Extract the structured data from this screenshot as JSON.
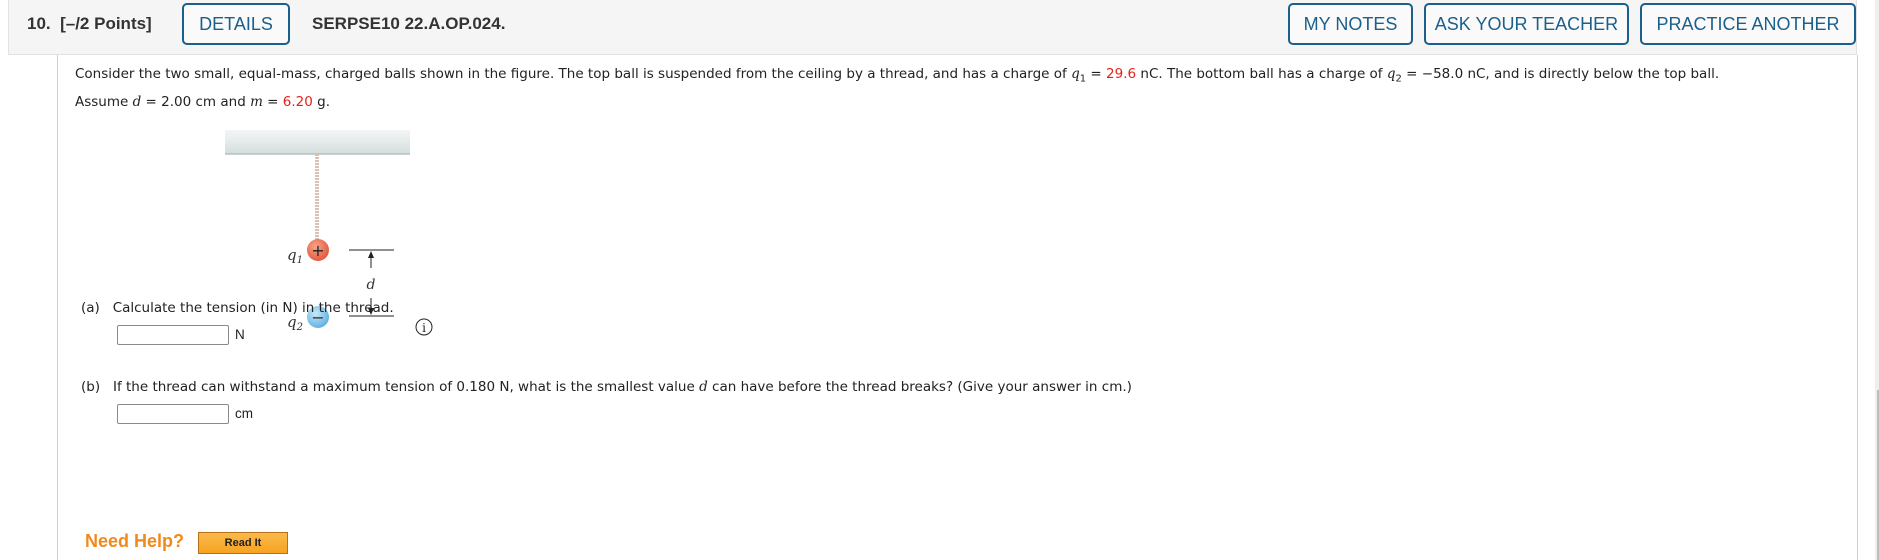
{
  "header": {
    "question_number": "10.",
    "points": "[–/2 Points]",
    "details_label": "DETAILS",
    "problem_code": "SERPSE10 22.A.OP.024.",
    "buttons": {
      "my_notes": "MY NOTES",
      "ask_teacher": "ASK YOUR TEACHER",
      "practice_another": "PRACTICE ANOTHER"
    },
    "accent_color": "#1b5f8c"
  },
  "problem": {
    "t1": "Consider the two small, equal-mass, charged balls shown in the figure. The top ball is suspended from the ceiling by a thread, and has a charge of ",
    "q1_sym": "q",
    "q1_sub": "1",
    "eq1": " = ",
    "q1_value": "29.6",
    "t2": " nC. The bottom ball has a charge of ",
    "q2_sym": "q",
    "q2_sub": "2",
    "t3": " = −58.0 nC, and is directly below the top ball.",
    "t4": "Assume ",
    "d_sym": "d",
    "t5": " = 2.00 cm and ",
    "m_sym": "m",
    "eq2": " = ",
    "m_value": "6.20",
    "t6": " g.",
    "highlight_color": "#e8201a"
  },
  "figure": {
    "q1_label": "q",
    "q1_sub": "1",
    "q2_label": "q",
    "q2_sub": "2",
    "plus": "+",
    "minus": "−",
    "d_label": "d",
    "info_icon": "i"
  },
  "parts": [
    {
      "label": "(a)",
      "text": "Calculate the tension (in N) in the thread.",
      "answer_value": "",
      "unit": "N"
    },
    {
      "label": "(b)",
      "text_pre": "If the thread can withstand a maximum tension of 0.180 N, what is the smallest value ",
      "d_sym": "d",
      "text_post": " can have before the thread breaks? (Give your answer in cm.)",
      "answer_value": "",
      "unit": "cm"
    }
  ],
  "help": {
    "label": "Need Help?",
    "read_it": "Read It",
    "color": "#f08a1c"
  }
}
